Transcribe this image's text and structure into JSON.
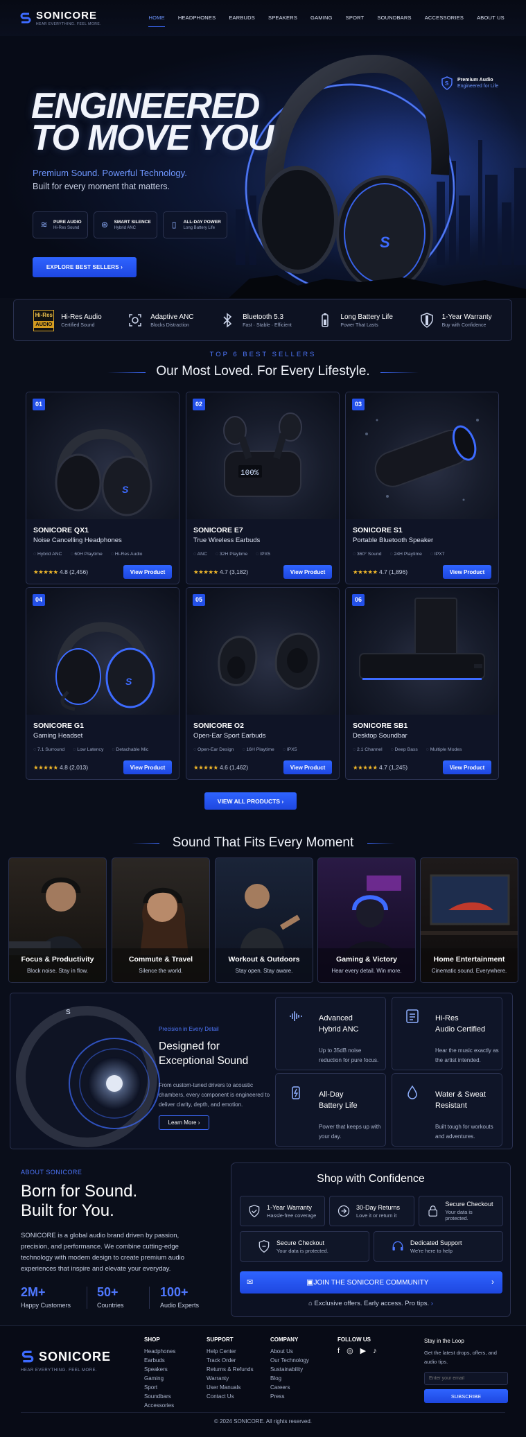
{
  "brand": {
    "name": "SONICORE",
    "tagline": "HEAR EVERYTHING. FEEL MORE.",
    "footer_tagline": "HEAR EVERYTHING. FEEL MORE."
  },
  "nav": {
    "items": [
      "HOME",
      "HEADPHONES",
      "EARBUDS",
      "SPEAKERS",
      "GAMING",
      "SPORT",
      "SOUNDBARS",
      "ACCESSORIES",
      "ABOUT US"
    ],
    "active": "HOME"
  },
  "hero": {
    "badge_title": "Premium Audio",
    "badge_sub": "Engineered for Life",
    "title_line1": "ENGINEERED",
    "title_line2": "TO MOVE YOU",
    "subtitle": "Premium Sound. Powerful Technology.",
    "subtitle2": "Built for every moment that matters.",
    "chips": [
      {
        "t": "PURE AUDIO",
        "s": "Hi-Res Sound"
      },
      {
        "t": "SMART SILENCE",
        "s": "Hybrid ANC"
      },
      {
        "t": "ALL-DAY POWER",
        "s": "Long Battery Life"
      }
    ],
    "cta": "EXPLORE BEST SELLERS  ›",
    "product_logo": "S"
  },
  "features": [
    {
      "icon": "hi-res-audio-icon",
      "t": "Hi-Res Audio",
      "s": "Certified Sound",
      "badge_top": "Hi-Res",
      "badge_bottom": "AUDIO"
    },
    {
      "icon": "adaptive-anc-icon",
      "t": "Adaptive ANC",
      "s": "Blocks Distraction"
    },
    {
      "icon": "bluetooth-icon",
      "t": "Bluetooth 5.3",
      "s": "Fast · Stable · Efficient"
    },
    {
      "icon": "battery-icon",
      "t": "Long Battery Life",
      "s": "Power That Lasts"
    },
    {
      "icon": "shield-icon",
      "t": "1-Year Warranty",
      "s": "Buy with Confidence"
    }
  ],
  "bestsellers": {
    "eyebrow": "TOP 6 BEST SELLERS",
    "title": "Our Most Loved. For Every Lifestyle.",
    "view_label": "View Product",
    "view_all": "VIEW ALL PRODUCTS  ›",
    "products": [
      {
        "num": "01",
        "name": "SONICORE QX1",
        "desc": "Noise Cancelling Headphones",
        "specs": [
          "Hybrid ANC",
          "60H Playtime",
          "Hi-Res Audio"
        ],
        "stars": "★★★★★",
        "rating": "4.8 (2,456)"
      },
      {
        "num": "02",
        "name": "SONICORE E7",
        "desc": "True Wireless Earbuds",
        "specs": [
          "ANC",
          "32H Playtime",
          "IPX5"
        ],
        "stars": "★★★★★",
        "rating": "4.7 (3,182)",
        "case_display": "100%"
      },
      {
        "num": "03",
        "name": "SONICORE S1",
        "desc": "Portable Bluetooth Speaker",
        "specs": [
          "360° Sound",
          "24H Playtime",
          "IPX7"
        ],
        "stars": "★★★★★",
        "rating": "4.7 (1,896)"
      },
      {
        "num": "04",
        "name": "SONICORE G1",
        "desc": "Gaming Headset",
        "specs": [
          "7.1 Surround",
          "Low Latency",
          "Detachable Mic"
        ],
        "stars": "★★★★★",
        "rating": "4.8 (2,013)"
      },
      {
        "num": "05",
        "name": "SONICORE O2",
        "desc": "Open-Ear Sport Earbuds",
        "specs": [
          "Open-Ear Design",
          "16H Playtime",
          "IPX5"
        ],
        "stars": "★★★★★",
        "rating": "4.6 (1,462)"
      },
      {
        "num": "06",
        "name": "SONICORE SB1",
        "desc": "Desktop Soundbar",
        "specs": [
          "2.1 Channel",
          "Deep Bass",
          "Multiple Modes"
        ],
        "stars": "★★★★★",
        "rating": "4.7 (1,245)"
      }
    ]
  },
  "moments": {
    "title": "Sound That Fits Every Moment",
    "items": [
      {
        "t": "Focus & Productivity",
        "s": "Block noise. Stay in flow."
      },
      {
        "t": "Commute & Travel",
        "s": "Silence the world."
      },
      {
        "t": "Workout & Outdoors",
        "s": "Stay open. Stay aware."
      },
      {
        "t": "Gaming & Victory",
        "s": "Hear every detail. Win more."
      },
      {
        "t": "Home Entertainment",
        "s": "Cinematic sound. Everywhere."
      }
    ]
  },
  "tech": {
    "eyebrow": "Precision in Every Detail",
    "title_line1": "Designed for",
    "title_line2": "Exceptional Sound",
    "text": "From custom-tuned drivers to acoustic chambers, every component is engineered to deliver clarity, depth, and emotion.",
    "cta": "Learn More  ›",
    "boxes": [
      {
        "icon": "anc-wave-icon",
        "t1": "Advanced",
        "t2": "Hybrid ANC",
        "d": "Up to 35dB noise reduction for pure focus."
      },
      {
        "icon": "hi-res-certified-icon",
        "t1": "Hi-Res",
        "t2": "Audio Certified",
        "d": "Hear the music exactly as the artist intended."
      },
      {
        "icon": "battery-charge-icon",
        "t1": "All-Day",
        "t2": "Battery Life",
        "d": "Power that keeps up with your day."
      },
      {
        "icon": "water-drop-icon",
        "t1": "Water & Sweat",
        "t2": "Resistant",
        "d": "Built tough for workouts and adventures."
      }
    ]
  },
  "about": {
    "eyebrow": "ABOUT SONICORE",
    "title1": "Born for Sound.",
    "title2": "Built for You.",
    "text": "SONICORE is a global audio brand driven by passion, precision, and performance. We combine cutting-edge technology with modern design to create premium audio experiences that inspire and elevate your everyday.",
    "stats": [
      {
        "v": "2M+",
        "l": "Happy Customers"
      },
      {
        "v": "50+",
        "l": "Countries"
      },
      {
        "v": "100+",
        "l": "Audio Experts"
      }
    ]
  },
  "confidence": {
    "title": "Shop with Confidence",
    "row1": [
      {
        "icon": "shield-check-icon",
        "t": "1-Year Warranty",
        "s": "Hassle-free coverage"
      },
      {
        "icon": "return-icon",
        "t": "30-Day Returns",
        "s": "Love it or return it"
      },
      {
        "icon": "lock-icon",
        "t": "Secure Checkout",
        "s": "Your data is protected."
      }
    ],
    "row2": [
      {
        "icon": "shield-icon",
        "t": "Secure Checkout",
        "s": "Your data is protected."
      },
      {
        "icon": "headset-icon",
        "t": "Dedicated Support",
        "s": "We're here to help"
      }
    ],
    "join": "JOIN THE SONICORE COMMUNITY",
    "offers": "Exclusive offers. Early access. Pro tips."
  },
  "footer": {
    "cols": [
      {
        "h": "SHOP",
        "items": [
          "Headphones",
          "Earbuds",
          "Speakers",
          "Gaming",
          "Sport",
          "Soundbars",
          "Accessories"
        ]
      },
      {
        "h": "SUPPORT",
        "items": [
          "Help Center",
          "Track Order",
          "Returns & Refunds",
          "Warranty",
          "User Manuals",
          "Contact Us"
        ]
      },
      {
        "h": "COMPANY",
        "items": [
          "About Us",
          "Our Technology",
          "Sustainability",
          "Blog",
          "Careers",
          "Press"
        ]
      }
    ],
    "follow": "FOLLOW US",
    "newsletter_title": "Stay in the Loop",
    "newsletter_text": "Get the latest drops, offers, and audio tips.",
    "email_placeholder": "Enter your email",
    "subscribe": "SUBSCRIBE",
    "copyright": "© 2024 SONICORE. All rights reserved."
  },
  "colors": {
    "accent": "#2f64ff",
    "bg": "#0a0e1a",
    "star": "#f2b92a"
  }
}
